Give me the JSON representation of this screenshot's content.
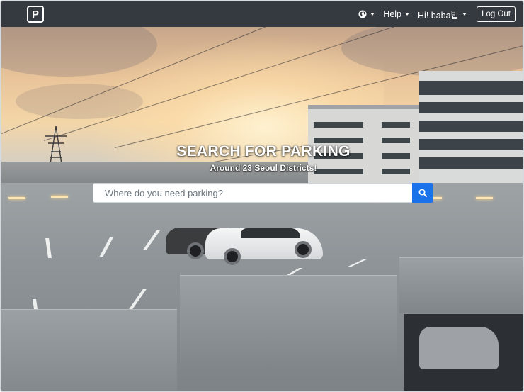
{
  "navbar": {
    "brand_letter": "P",
    "language_icon": "globe-icon",
    "help_label": "Help",
    "user_label": "Hi! baba밥",
    "logout_label": "Log Out"
  },
  "hero": {
    "headline": "SEARCH FOR PARKING",
    "subline": "Around 23 Seoul Districts!",
    "search_placeholder": "Where do you need parking?",
    "search_value": "",
    "search_button_icon": "search-icon"
  },
  "colors": {
    "navbar_bg": "#343a40",
    "search_button": "#1a73e8"
  }
}
